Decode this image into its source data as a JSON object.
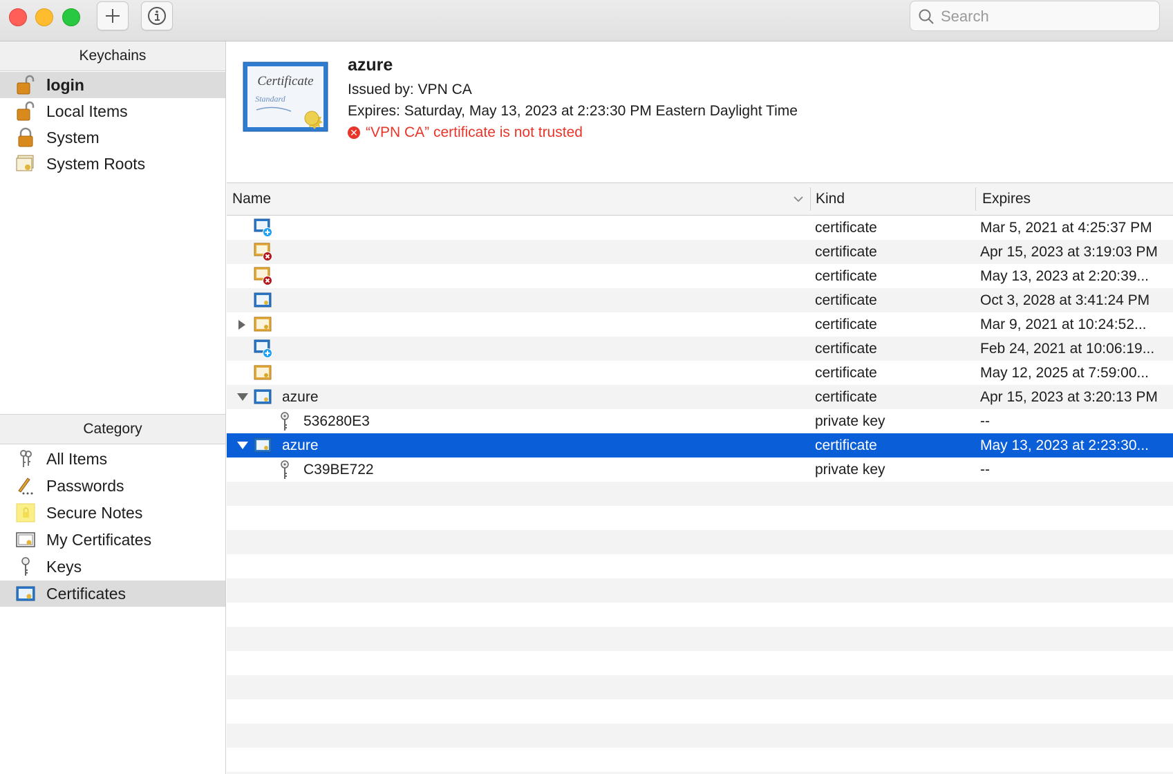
{
  "toolbar": {
    "add_icon": "plus-icon",
    "info_icon": "info-icon",
    "search_placeholder": "Search"
  },
  "sidebar": {
    "keychains_header": "Keychains",
    "keychains": [
      {
        "label": "login",
        "icon": "lock-open-icon",
        "selected": true
      },
      {
        "label": "Local Items",
        "icon": "lock-open-icon",
        "selected": false
      },
      {
        "label": "System",
        "icon": "lock-icon",
        "selected": false
      },
      {
        "label": "System Roots",
        "icon": "certificate-icon",
        "selected": false
      }
    ],
    "category_header": "Category",
    "categories": [
      {
        "label": "All Items",
        "icon": "keys-icon",
        "selected": false
      },
      {
        "label": "Passwords",
        "icon": "pencil-dots-icon",
        "selected": false
      },
      {
        "label": "Secure Notes",
        "icon": "note-icon",
        "selected": false
      },
      {
        "label": "My Certificates",
        "icon": "certificate-icon",
        "selected": false
      },
      {
        "label": "Keys",
        "icon": "key-icon",
        "selected": false
      },
      {
        "label": "Certificates",
        "icon": "certificate-icon",
        "selected": true
      }
    ]
  },
  "detail": {
    "title": "azure",
    "issued_by": "Issued by: VPN CA",
    "expires": "Expires: Saturday, May 13, 2023 at 2:23:30 PM Eastern Daylight Time",
    "warning": "“VPN CA” certificate is not trusted",
    "big_icon_text1": "Certificate",
    "big_icon_text2": "Standard"
  },
  "table": {
    "columns": {
      "name": "Name",
      "kind": "Kind",
      "expires": "Expires"
    },
    "rows": [
      {
        "name": "",
        "kind": "certificate",
        "expires": "Mar 5, 2021 at 4:25:37 PM",
        "icon": "cert-plus-icon",
        "disclosure": "none",
        "indent": 0
      },
      {
        "name": "",
        "kind": "certificate",
        "expires": "Apr 15, 2023 at 3:19:03 PM",
        "icon": "cert-error-icon",
        "disclosure": "none",
        "indent": 0
      },
      {
        "name": "",
        "kind": "certificate",
        "expires": "May 13, 2023 at 2:20:39...",
        "icon": "cert-error-icon",
        "disclosure": "none",
        "indent": 0
      },
      {
        "name": "",
        "kind": "certificate",
        "expires": "Oct 3, 2028 at 3:41:24 PM",
        "icon": "cert-blue-icon",
        "disclosure": "none",
        "indent": 0
      },
      {
        "name": "",
        "kind": "certificate",
        "expires": "Mar 9, 2021 at 10:24:52...",
        "icon": "cert-gold-icon",
        "disclosure": "collapsed",
        "indent": 0
      },
      {
        "name": "",
        "kind": "certificate",
        "expires": "Feb 24, 2021 at 10:06:19...",
        "icon": "cert-plus-icon",
        "disclosure": "none",
        "indent": 0
      },
      {
        "name": "",
        "kind": "certificate",
        "expires": "May 12, 2025 at 7:59:00...",
        "icon": "cert-gold-icon",
        "disclosure": "none",
        "indent": 0
      },
      {
        "name": "azure",
        "kind": "certificate",
        "expires": "Apr 15, 2023 at 3:20:13 PM",
        "icon": "cert-blue-icon",
        "disclosure": "expanded",
        "indent": 0
      },
      {
        "name": "536280E3",
        "kind": "private key",
        "expires": "--",
        "icon": "key-icon",
        "disclosure": "none",
        "indent": 1
      },
      {
        "name": "azure",
        "kind": "certificate",
        "expires": "May 13, 2023 at 2:23:30...",
        "icon": "cert-blue-icon",
        "disclosure": "expanded",
        "indent": 0,
        "selected": true
      },
      {
        "name": "C39BE722",
        "kind": "private key",
        "expires": "--",
        "icon": "key-icon",
        "disclosure": "none",
        "indent": 1
      }
    ]
  },
  "colors": {
    "selection": "#0a5fd8",
    "warning": "#e8352a",
    "close": "#ff5f57",
    "minimize": "#febc2e",
    "maximize": "#28c840"
  }
}
